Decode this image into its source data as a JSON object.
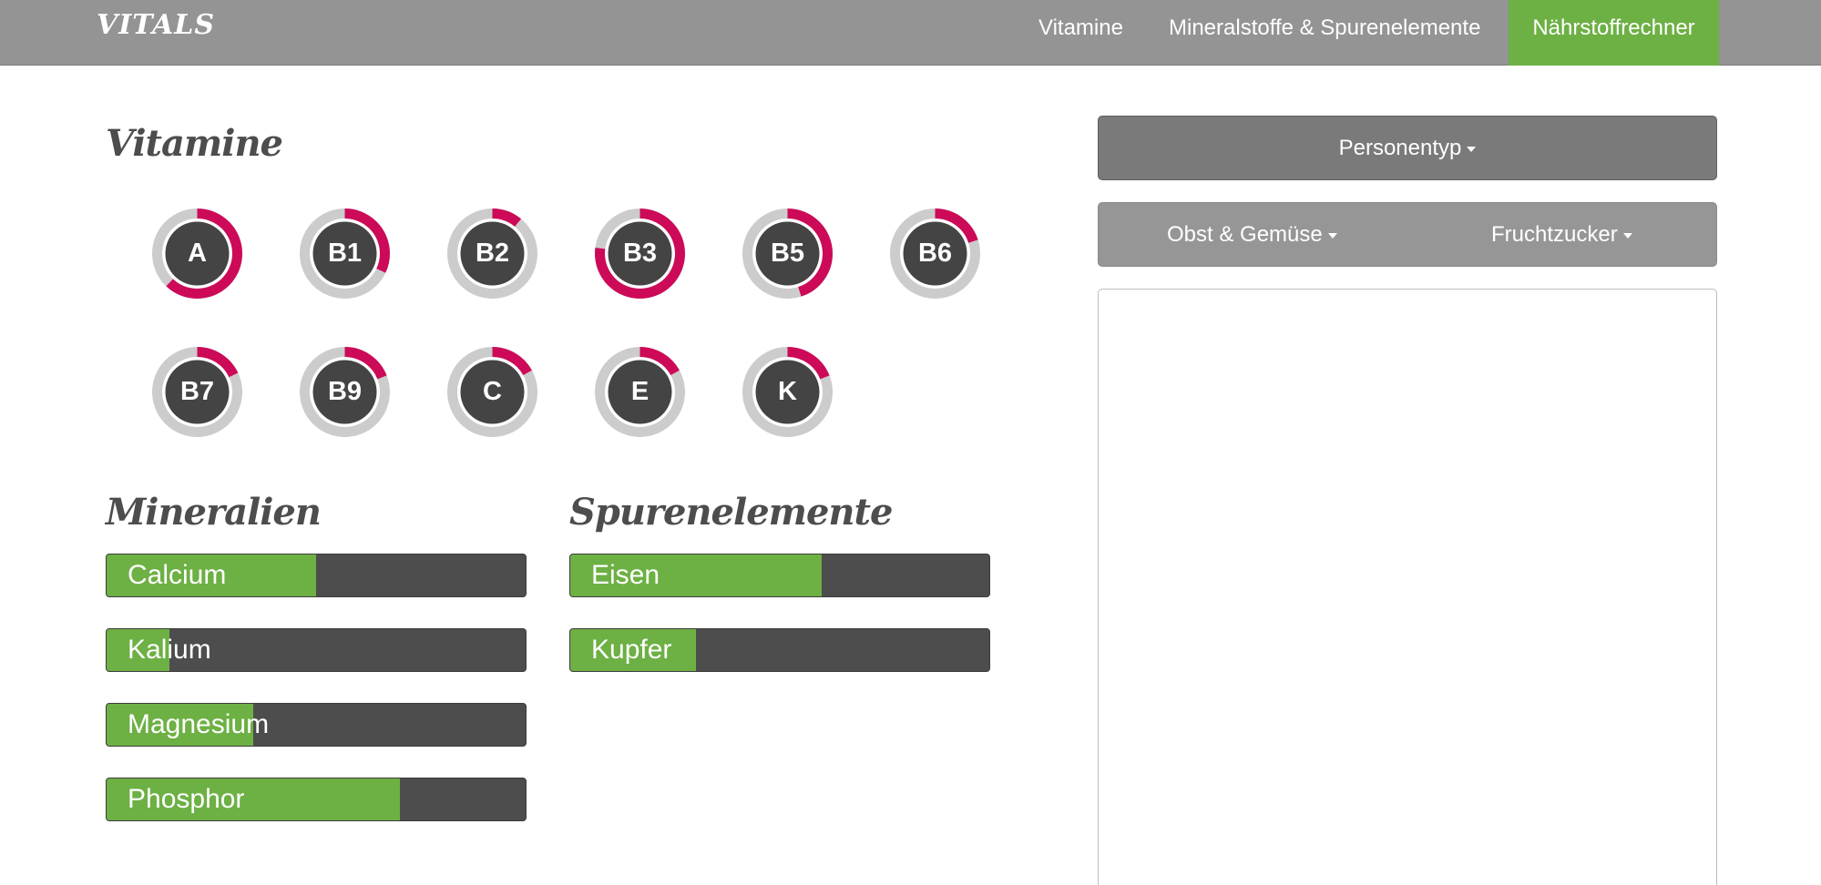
{
  "nav": {
    "brand": "VITALS",
    "items": [
      {
        "label": "Vitamine"
      },
      {
        "label": "Mineralstoffe & Spurenelemente"
      },
      {
        "label": "Nährstoffrechner",
        "active": true
      }
    ]
  },
  "sections": {
    "vitamine": "Vitamine",
    "mineralien": "Mineralien",
    "spurenelemente": "Spurenelemente"
  },
  "colors": {
    "accent": "#6db044",
    "ring_progress": "#cc0a58",
    "ring_track": "#cccccc",
    "dark": "#444444"
  },
  "vitamins": [
    {
      "label": "A",
      "fill": 0.62
    },
    {
      "label": "B1",
      "fill": 0.32
    },
    {
      "label": "B2",
      "fill": 0.11
    },
    {
      "label": "B3",
      "fill": 0.77
    },
    {
      "label": "B5",
      "fill": 0.45
    },
    {
      "label": "B6",
      "fill": 0.2
    },
    {
      "label": "B7",
      "fill": 0.18
    },
    {
      "label": "B9",
      "fill": 0.19
    },
    {
      "label": "C",
      "fill": 0.17
    },
    {
      "label": "E",
      "fill": 0.17
    },
    {
      "label": "K",
      "fill": 0.19
    }
  ],
  "minerals": [
    {
      "label": "Calcium",
      "fill": 0.5
    },
    {
      "label": "Kalium",
      "fill": 0.15
    },
    {
      "label": "Magnesium",
      "fill": 0.35
    },
    {
      "label": "Phosphor",
      "fill": 0.7
    }
  ],
  "trace": [
    {
      "label": "Eisen",
      "fill": 0.6
    },
    {
      "label": "Kupfer",
      "fill": 0.3
    }
  ],
  "panel": {
    "person_label": "Personentyp",
    "obst_label": "Obst & Gemüse",
    "frucht_label": "Fruchtzucker"
  }
}
